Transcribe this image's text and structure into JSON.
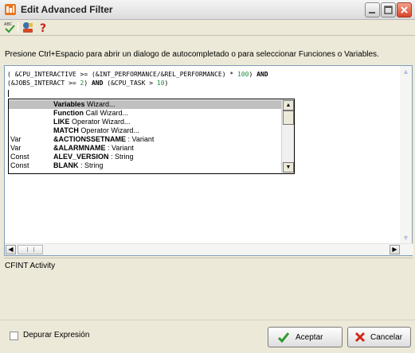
{
  "window": {
    "title": "Edit Advanced Filter"
  },
  "toolbar": {
    "icons": [
      "spellcheck-icon",
      "function-wizard-icon",
      "help-icon"
    ],
    "help_glyph": "?"
  },
  "hint": "Presione Ctrl+Espacio para abrir un dialogo de autocompletado o para seleccionar Funciones o Variables.",
  "editor": {
    "line1": {
      "p1": "( &CPU_INTERACTIVE >= (&INT_PERFORMANCE/&REL_PERFORMANCE) * ",
      "n1": "100",
      "p2": ") ",
      "k1": "AND"
    },
    "line2": {
      "p1": "(&JOBS_INTERACT >= ",
      "n1": "2",
      "p2": ") ",
      "k1": "AND",
      "p3": " (&CPU_TASK > ",
      "n2": "10",
      "p4": ")"
    }
  },
  "autocomplete": {
    "items": [
      {
        "type": "",
        "name": "Variables",
        "detail": " Wizard...",
        "selected": true
      },
      {
        "type": "",
        "name": "Function",
        "detail": " Call Wizard..."
      },
      {
        "type": "",
        "name": "LIKE",
        "detail": " Operator Wizard..."
      },
      {
        "type": "",
        "name": "MATCH",
        "detail": " Operator Wizard..."
      },
      {
        "type": "Var",
        "name": "&ACTIONSSETNAME",
        "detail": " : Variant"
      },
      {
        "type": "Var",
        "name": "&ALARMNAME",
        "detail": " : Variant"
      },
      {
        "type": "Const",
        "name": "ALEV_VERSION",
        "detail": " : String"
      },
      {
        "type": "Const",
        "name": "BLANK",
        "detail": " : String"
      }
    ]
  },
  "description": {
    "text": "CFINT Activity"
  },
  "footer": {
    "debug_label": "Depurar Expresión",
    "debug_checked": false,
    "ok_label": "Aceptar",
    "cancel_label": "Cancelar"
  },
  "colors": {
    "number": "#1e8a3a",
    "selection": "#c0c0c0",
    "editor_border": "#7f9db9"
  }
}
